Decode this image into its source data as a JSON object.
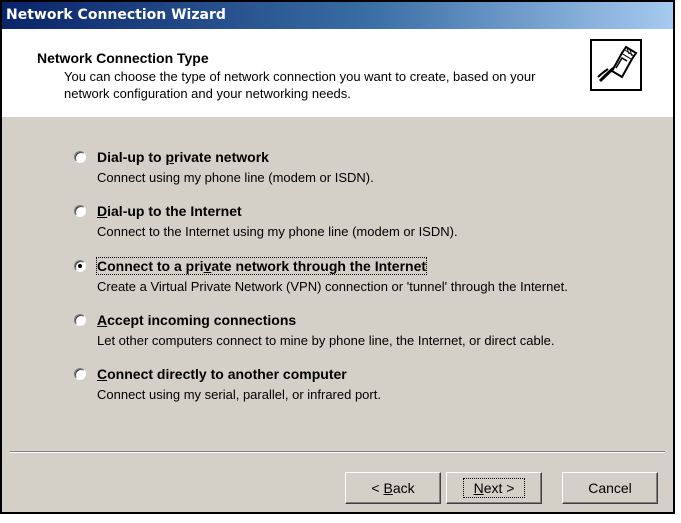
{
  "window": {
    "title": "Network Connection Wizard"
  },
  "header": {
    "title": "Network Connection Type",
    "subtitle": "You can choose the type of network connection you want to create, based on your network configuration and your networking needs.",
    "icon": "network-cable-icon"
  },
  "options": [
    {
      "label_pre": "Dial-up to ",
      "label_access": "p",
      "label_post": "rivate network",
      "description": "Connect using my phone line (modem or ISDN).",
      "selected": false
    },
    {
      "label_pre": "",
      "label_access": "D",
      "label_post": "ial-up to the Internet",
      "description": "Connect to the Internet using my phone line (modem or ISDN).",
      "selected": false
    },
    {
      "label_pre": "Connect to a pri",
      "label_access": "v",
      "label_post": "ate network through the Internet",
      "description": "Create a Virtual Private Network (VPN) connection or 'tunnel' through the Internet.",
      "selected": true
    },
    {
      "label_pre": "",
      "label_access": "A",
      "label_post": "ccept incoming connections",
      "description": "Let other computers connect to mine by phone line, the Internet, or direct cable.",
      "selected": false
    },
    {
      "label_pre": "",
      "label_access": "C",
      "label_post": "onnect directly to another computer",
      "description": "Connect using my serial, parallel, or infrared port.",
      "selected": false
    }
  ],
  "buttons": {
    "back_pre": "< ",
    "back_access": "B",
    "back_post": "ack",
    "next_access": "N",
    "next_post": "ext >",
    "cancel": "Cancel"
  }
}
